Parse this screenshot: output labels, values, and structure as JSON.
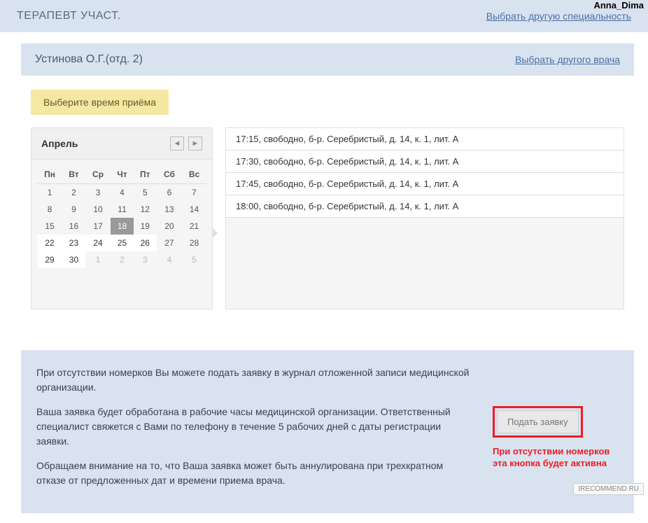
{
  "watermark": {
    "top": "Anna_Dima",
    "bottom": "IRECOMMEND.RU"
  },
  "specialty": {
    "title": "ТЕРАПЕВТ УЧАСТ.",
    "change_link": "Выбрать другую специальность"
  },
  "doctor": {
    "name": "Устинова О.Г.(отд. 2)",
    "change_link": "Выбрать другого врача"
  },
  "time_select_label": "Выберите время приёма",
  "calendar": {
    "month": "Апрель",
    "weekdays": [
      "Пн",
      "Вт",
      "Ср",
      "Чт",
      "Пт",
      "Сб",
      "Вс"
    ],
    "weeks": [
      [
        {
          "d": "1"
        },
        {
          "d": "2"
        },
        {
          "d": "3"
        },
        {
          "d": "4"
        },
        {
          "d": "5"
        },
        {
          "d": "6"
        },
        {
          "d": "7"
        }
      ],
      [
        {
          "d": "8"
        },
        {
          "d": "9"
        },
        {
          "d": "10"
        },
        {
          "d": "11"
        },
        {
          "d": "12"
        },
        {
          "d": "13"
        },
        {
          "d": "14"
        }
      ],
      [
        {
          "d": "15"
        },
        {
          "d": "16"
        },
        {
          "d": "17"
        },
        {
          "d": "18",
          "cls": "selected"
        },
        {
          "d": "19"
        },
        {
          "d": "20"
        },
        {
          "d": "21"
        }
      ],
      [
        {
          "d": "22",
          "cls": "avail"
        },
        {
          "d": "23",
          "cls": "avail"
        },
        {
          "d": "24",
          "cls": "avail"
        },
        {
          "d": "25",
          "cls": "avail"
        },
        {
          "d": "26",
          "cls": "avail"
        },
        {
          "d": "27"
        },
        {
          "d": "28"
        }
      ],
      [
        {
          "d": "29",
          "cls": "avail"
        },
        {
          "d": "30",
          "cls": "avail"
        },
        {
          "d": "1",
          "cls": "dim"
        },
        {
          "d": "2",
          "cls": "dim"
        },
        {
          "d": "3",
          "cls": "dim"
        },
        {
          "d": "4",
          "cls": "dim"
        },
        {
          "d": "5",
          "cls": "dim"
        }
      ]
    ]
  },
  "slots": [
    "17:15, свободно, б-р. Серебристый, д. 14, к. 1, лит. А",
    "17:30, свободно, б-р. Серебристый, д. 14, к. 1, лит. А",
    "17:45, свободно, б-р. Серебристый, д. 14, к. 1, лит. А",
    "18:00, свободно, б-р. Серебристый, д. 14, к. 1, лит. А"
  ],
  "info": {
    "p1": "При отсутствии номерков Вы можете подать заявку в журнал отложенной записи медицинской организации.",
    "p2": "Ваша заявка будет обработана в рабочие часы медицинской организации. Ответственный специалист свяжется с Вами по телефону в течение 5 рабочих дней с даты регистрации заявки.",
    "p3": "Обращаем внимание на то, что Ваша заявка может быть аннулирована при трехкратном отказе от предложенных дат и времени приема врача.",
    "submit_label": "Подать заявку",
    "red_note": "При отсутствии номерков эта кнопка будет активна"
  }
}
